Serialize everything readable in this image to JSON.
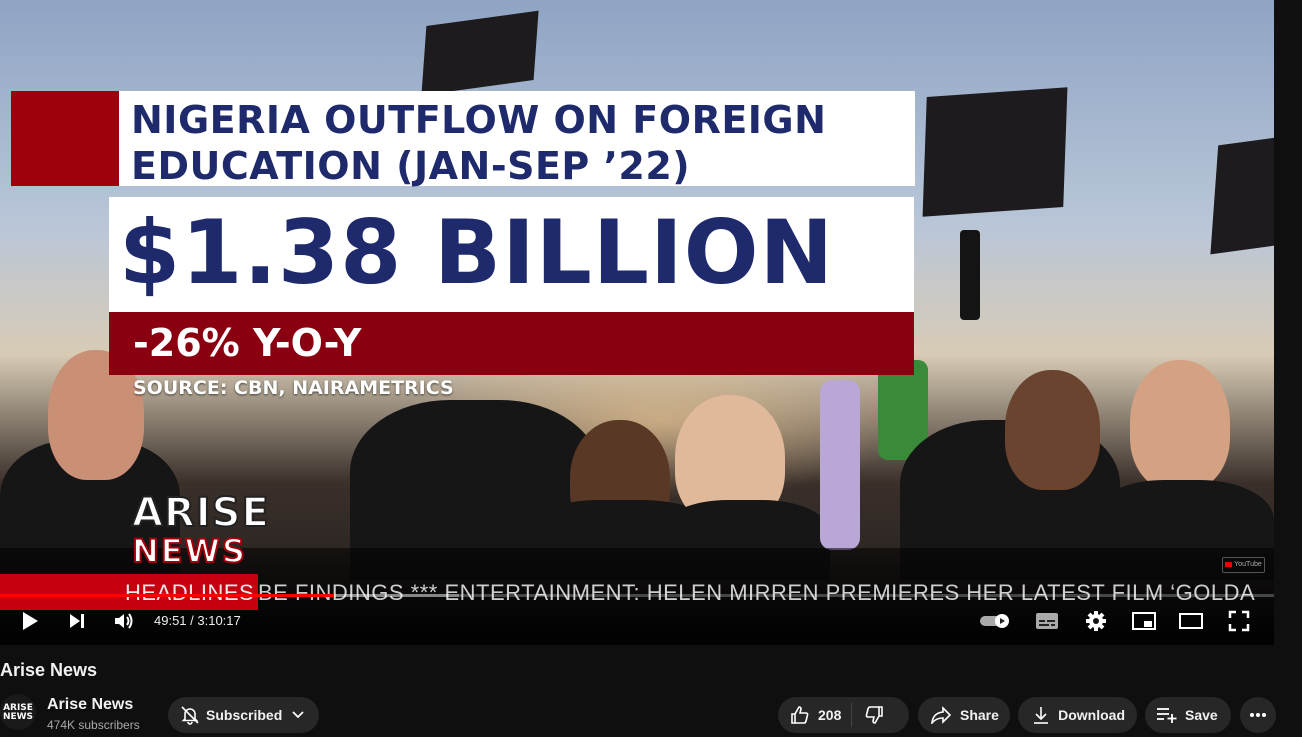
{
  "overlay": {
    "title_line1": "NIGERIA OUTFLOW ON FOREIGN",
    "title_line2": "EDUCATION (JAN-SEP ’22)",
    "amount": "$1.38 BILLION",
    "change": "-26% Y-O-Y",
    "source": "SOURCE: CBN, NAIRAMETRICS"
  },
  "logo": {
    "line1": "ARISE",
    "line2": "NEWS"
  },
  "ticker": {
    "headline_label": "HEADLINES",
    "text": "BE FINDINGS  ***  ENTERTAINMENT: HELEN MIRREN PREMIERES HER LATEST FILM ‘GOLDA"
  },
  "player": {
    "current_time": "49:51",
    "duration": "3:10:17",
    "time_display": "49:51 / 3:10:17",
    "progress_fraction": 0.262,
    "buffered_fraction": 0.36,
    "accent_color": "#ff0000"
  },
  "video": {
    "title": "Arise News",
    "channel_name": "Arise News",
    "subscribers": "474K subscribers",
    "avatar_text": "ARISE NEWS"
  },
  "actions": {
    "subscribed_label": "Subscribed",
    "like_count": "208",
    "share_label": "Share",
    "download_label": "Download",
    "save_label": "Save"
  },
  "icons": [
    "play-icon",
    "next-icon",
    "volume-icon",
    "autoplay-toggle-icon",
    "captions-icon",
    "settings-icon",
    "miniplayer-icon",
    "theater-icon",
    "fullscreen-icon",
    "bell-off-icon",
    "chevron-down-icon",
    "thumbs-up-icon",
    "thumbs-down-icon",
    "share-icon",
    "download-icon",
    "playlist-add-icon",
    "more-icon"
  ]
}
